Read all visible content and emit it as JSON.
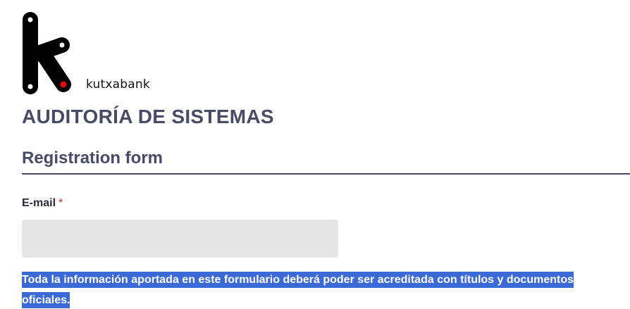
{
  "brand": {
    "name": "kutxabank",
    "logo_icon": "kutxabank-k-logo-icon",
    "logo_accent_color": "#e30613"
  },
  "header": {
    "title": "AUDITORÍA DE SISTEMAS"
  },
  "form": {
    "title": "Registration form",
    "fields": {
      "email": {
        "label": "E-mail",
        "required_marker": "*",
        "value": "",
        "placeholder": ""
      }
    },
    "notice": "Toda la información aportada en este formulario deberá poder ser acreditada con títulos y documentos oficiales."
  },
  "colors": {
    "heading": "#4a4a66",
    "input_background": "#e5e5e5",
    "selection_highlight": "#3b6ad6"
  }
}
